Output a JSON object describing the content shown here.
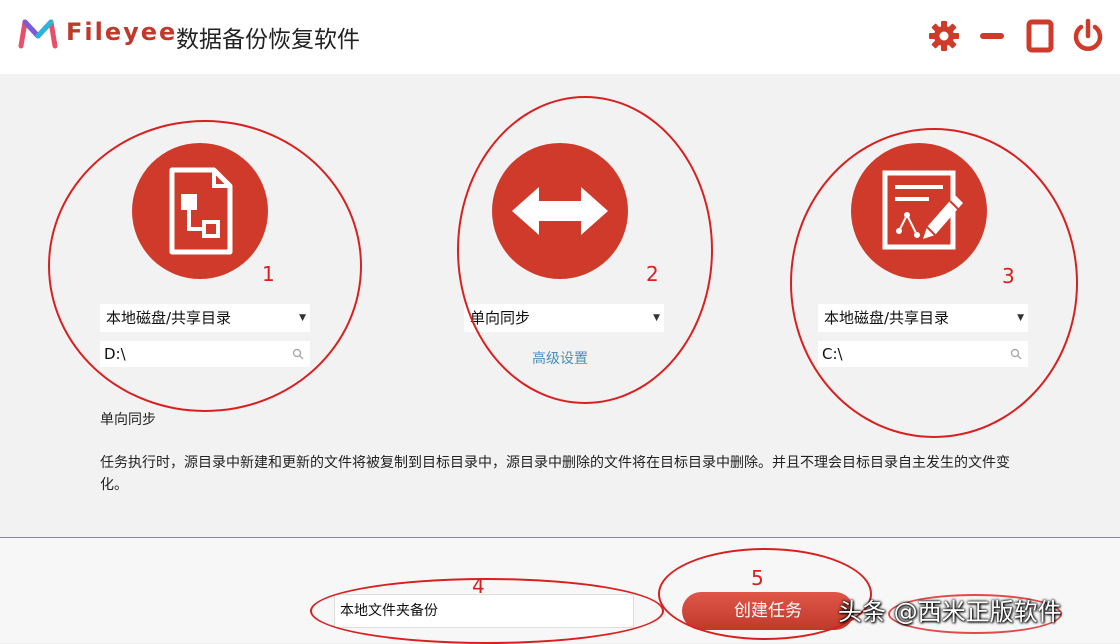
{
  "header": {
    "brand": "Fileyee",
    "title": "数据备份恢复软件",
    "settings_icon": "gear-icon",
    "minimize_icon": "minimize-icon",
    "maximize_icon": "maximize-icon",
    "power_icon": "power-icon",
    "accent_color": "#cf3a2a"
  },
  "source": {
    "icon": "source-document-icon",
    "type_value": "本地磁盘/共享目录",
    "path_value": "D:\\",
    "annotation": "1"
  },
  "sync": {
    "icon": "bidirectional-arrow-icon",
    "mode_value": "单向同步",
    "advanced_link": "高级设置",
    "annotation": "2"
  },
  "target": {
    "icon": "edit-document-icon",
    "type_value": "本地磁盘/共享目录",
    "path_value": "C:\\",
    "annotation": "3"
  },
  "mode_info": {
    "title": "单向同步",
    "description": "任务执行时，源目录中新建和更新的文件将被复制到目标目录中，源目录中删除的文件将在目标目录中删除。并且不理会目标目录自主发生的文件变化。"
  },
  "task": {
    "name_value": "本地文件夹备份",
    "name_annotation": "4",
    "create_label": "创建任务",
    "create_annotation": "5"
  },
  "watermark": "头条 @西米正版软件"
}
